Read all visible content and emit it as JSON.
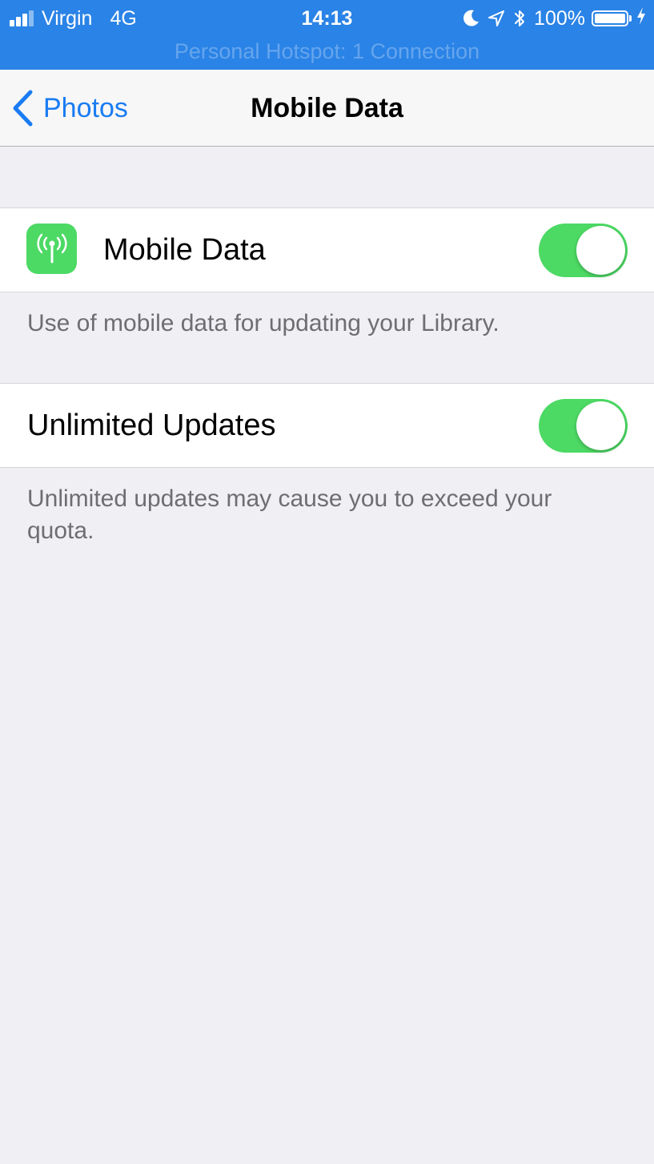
{
  "status_bar": {
    "carrier": "Virgin",
    "network": "4G",
    "time": "14:13",
    "battery": "100%",
    "hotspot_text": "Personal Hotspot: 1 Connection",
    "icons": [
      "signal-icon",
      "moon-icon",
      "location-arrow-icon",
      "bluetooth-icon",
      "battery-icon",
      "charging-bolt-icon"
    ]
  },
  "nav": {
    "back_label": "Photos",
    "title": "Mobile Data"
  },
  "settings": {
    "mobile_data": {
      "label": "Mobile Data",
      "icon": "antenna-icon",
      "enabled": true,
      "footer": "Use of mobile data for updating your Library."
    },
    "unlimited_updates": {
      "label": "Unlimited Updates",
      "enabled": true,
      "footer": "Unlimited updates may cause you to exceed your quota."
    }
  },
  "colors": {
    "status_bar": "#2a83e6",
    "accent": "#1a7cf2",
    "toggle_on": "#4cd964",
    "background": "#efeff4"
  }
}
